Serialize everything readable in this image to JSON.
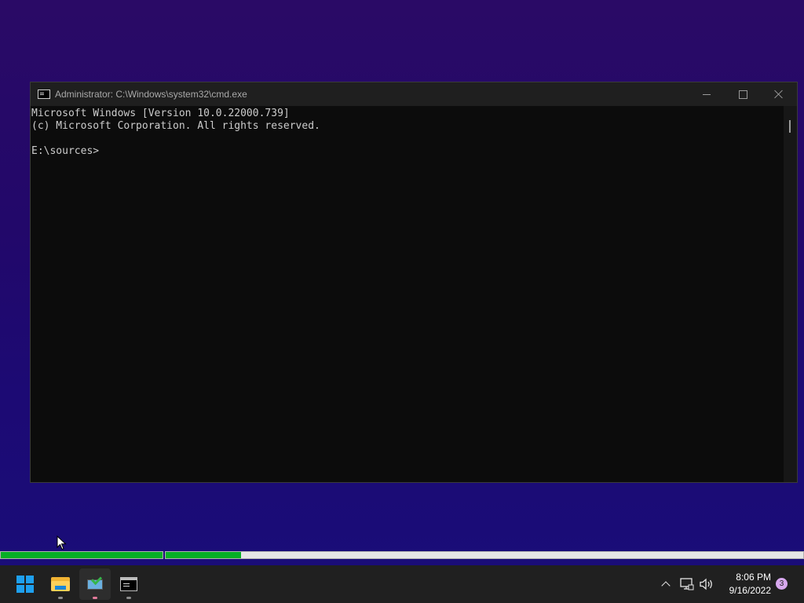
{
  "window": {
    "title": "Administrator: C:\\Windows\\system32\\cmd.exe",
    "icon": "cmd-icon"
  },
  "console": {
    "lines": [
      "Microsoft Windows [Version 10.0.22000.739]",
      "(c) Microsoft Corporation. All rights reserved.",
      "",
      "E:\\sources>"
    ]
  },
  "progress": {
    "overall_fraction": 1.0,
    "current_fraction": 0.118,
    "fill_color": "#06b025"
  },
  "taskbar": {
    "apps": [
      {
        "name": "start",
        "icon": "windows-logo-icon"
      },
      {
        "name": "file-explorer",
        "icon": "folder-icon"
      },
      {
        "name": "windows-setup",
        "icon": "setup-icon"
      },
      {
        "name": "command-prompt",
        "icon": "cmd-icon"
      }
    ],
    "tray": {
      "icons": [
        "chevron-up-icon",
        "network-icon",
        "volume-icon"
      ],
      "time": "8:06 PM",
      "date": "9/16/2022",
      "notification_count": "3"
    }
  }
}
